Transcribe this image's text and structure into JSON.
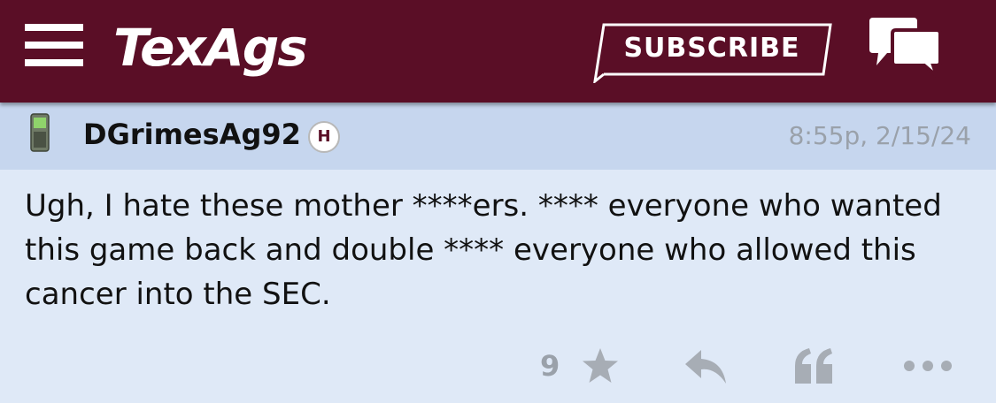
{
  "header": {
    "logo_text": "TexAgs",
    "subscribe_label": "SUBSCRIBE",
    "background_color": "#5a0e26",
    "icons": [
      "menu-icon",
      "chat-bubbles-icon"
    ]
  },
  "post": {
    "username": "DGrimesAg92",
    "badge": "H",
    "timestamp": "8:55p, 2/15/24",
    "body": "Ugh, I hate these mother ****ers. **** everyone who wanted this game back and double **** everyone who allowed this cancer into the SEC.",
    "star_count": "9",
    "device_icon": "phone-icon"
  },
  "actions": {
    "icons": [
      "star-icon",
      "reply-icon",
      "quote-icon",
      "more-icon"
    ]
  }
}
